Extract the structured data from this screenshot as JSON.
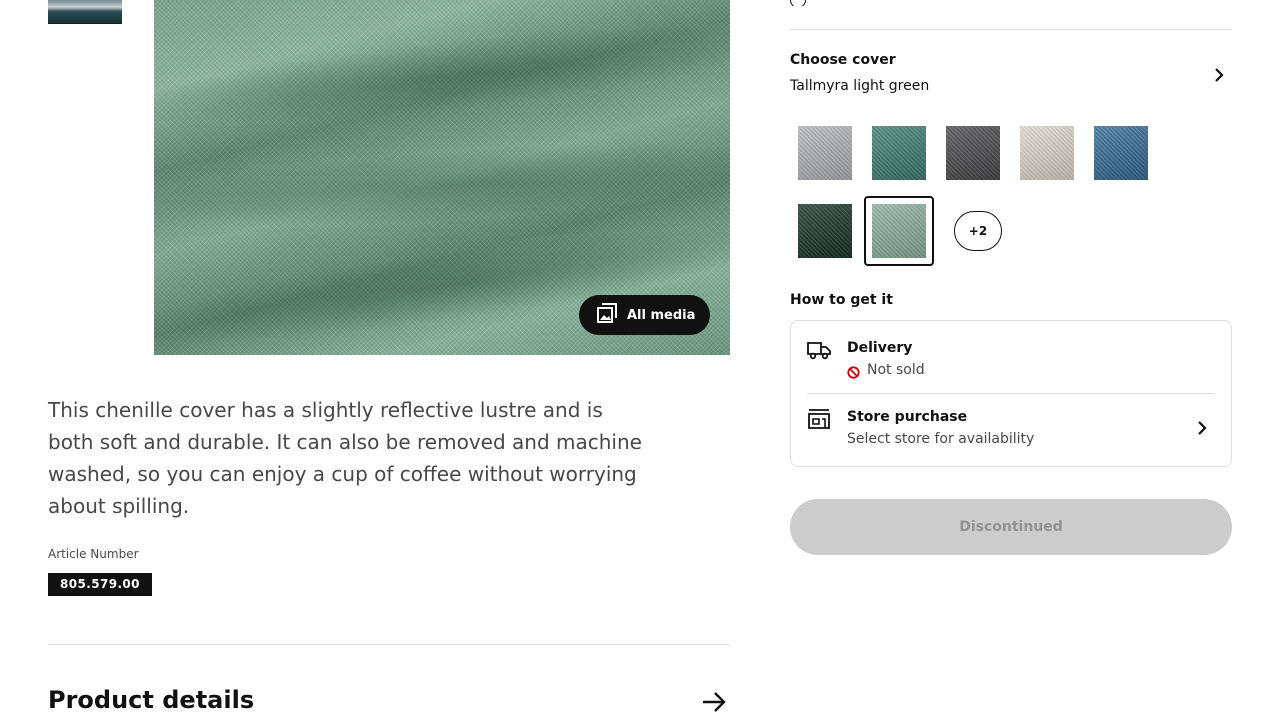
{
  "gallery": {
    "all_media_label": "All media",
    "all_media_icon": "gallery-icon"
  },
  "description": "This chenille cover has a slightly reflective lustre and is both soft and durable. It can also be removed and machine washed, so you can enjoy a cup of coffee without worrying about spilling.",
  "article": {
    "label": "Article Number",
    "number": "805.579.00"
  },
  "product_details": {
    "title": "Product details",
    "icon": "arrow-right-icon"
  },
  "cover": {
    "title": "Choose cover",
    "selected": "Tallmyra light green",
    "more_label": "+2",
    "swatches": [
      {
        "name": "light grey",
        "color": "#b7b8bb"
      },
      {
        "name": "green teal",
        "color": "#3f7e74"
      },
      {
        "name": "dark grey",
        "color": "#4a4a4c"
      },
      {
        "name": "beige",
        "color": "#e4dbd2"
      },
      {
        "name": "blue",
        "color": "#356c98"
      },
      {
        "name": "dark green",
        "color": "#173326"
      },
      {
        "name": "light green",
        "color": "#8fb3a1",
        "selected": true
      }
    ]
  },
  "how_to_get": {
    "title": "How to get it",
    "delivery": {
      "title": "Delivery",
      "status": "Not sold",
      "icon": "truck-icon",
      "status_icon": "not-available-icon",
      "status_color": "#cc0008"
    },
    "store": {
      "title": "Store purchase",
      "subtitle": "Select store for availability",
      "icon": "store-icon"
    }
  },
  "purchase": {
    "button_label": "Discontinued"
  },
  "colors": {
    "text": "#111111",
    "muted": "#484848",
    "border": "#dfdfdf",
    "disabled_bg": "#cccccc",
    "disabled_text": "#929292"
  }
}
